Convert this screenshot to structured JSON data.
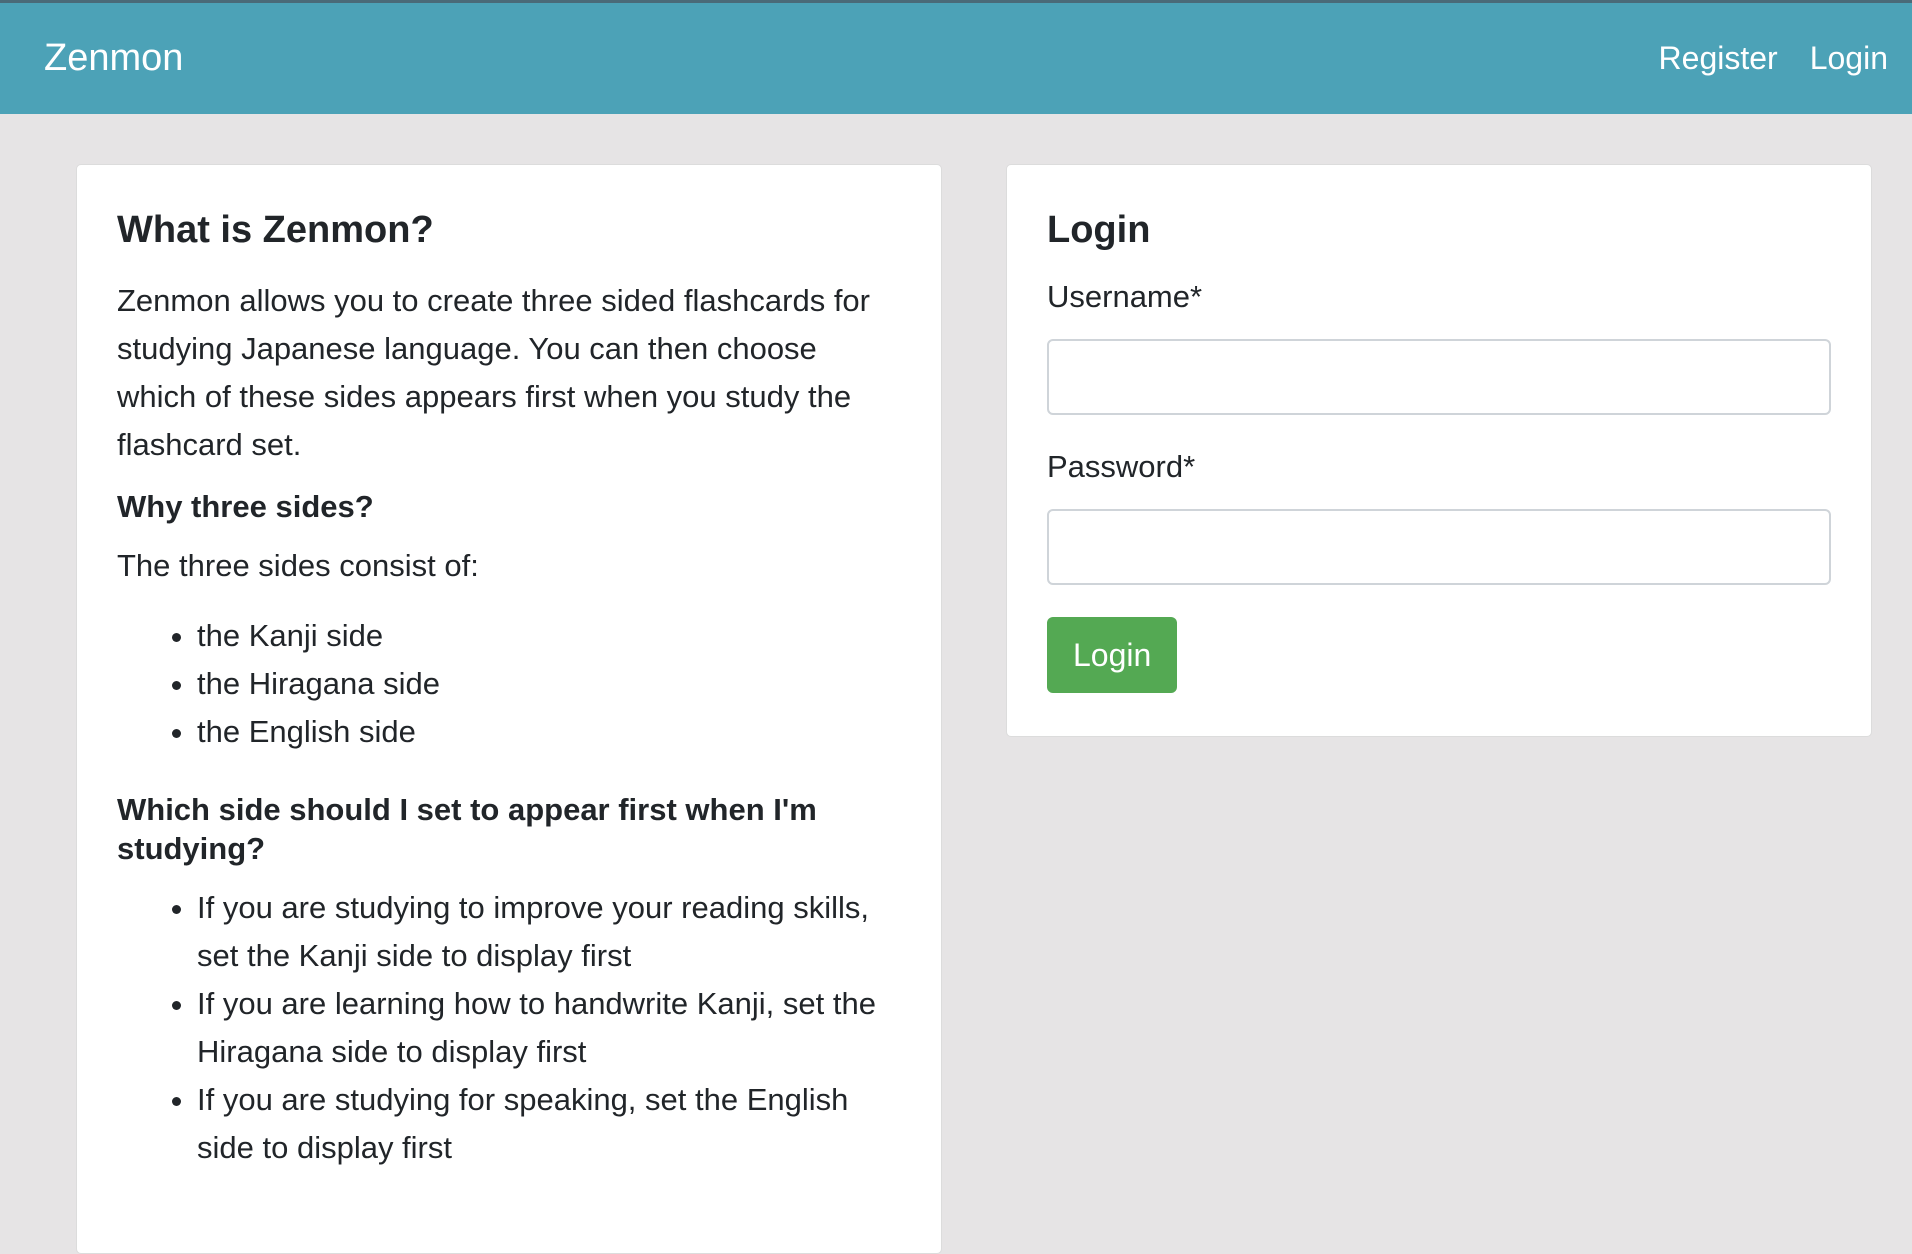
{
  "navbar": {
    "brand": "Zenmon",
    "links": [
      "Register",
      "Login"
    ],
    "color": "#4ca2b7"
  },
  "info": {
    "title": "What is Zenmon?",
    "intro": "Zenmon allows you to create three sided flashcards for studying Japanese language. You can then choose which of these sides appears first when you study the flashcard set.",
    "why_heading": "Why three sides?",
    "sides_intro": "The three sides consist of:",
    "sides": [
      "the Kanji side",
      "the Hiragana side",
      "the English side"
    ],
    "which_heading": "Which side should I set to appear first when I'm studying?",
    "tips": [
      "If you are studying to improve your reading skills, set the Kanji side to display first",
      "If you are learning how to handwrite Kanji, set the Hiragana side to display first",
      "If you are studying for speaking, set the English side to display first"
    ]
  },
  "login": {
    "title": "Login",
    "username_label": "Username*",
    "username_value": "",
    "password_label": "Password*",
    "password_value": "",
    "submit_label": "Login",
    "submit_color": "#54a953"
  }
}
